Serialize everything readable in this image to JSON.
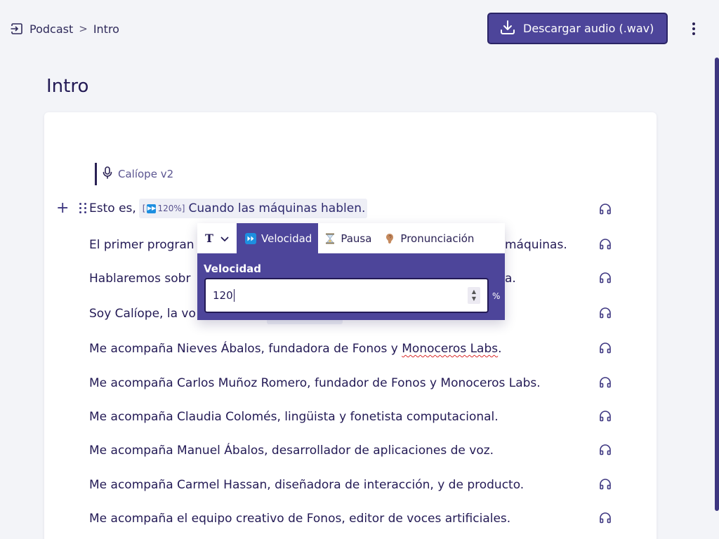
{
  "breadcrumb": {
    "root": "Podcast",
    "separator": ">",
    "current": "Intro"
  },
  "header": {
    "download_label": "Descargar audio (.wav)"
  },
  "page": {
    "title": "Intro"
  },
  "voice": {
    "name": "Calíope v2"
  },
  "first_line": {
    "prefix": "Esto es,",
    "tag": "120%]",
    "tag_open": "[",
    "highlighted": "Cuando las máquinas hablen."
  },
  "lines": [
    {
      "left": "El primer progran",
      "right": "máquinas."
    },
    {
      "left": "Hablaremos sobr",
      "right": "a."
    },
    {
      "left": "Soy Calíope, la vo",
      "right": ""
    },
    {
      "text_before": "Me acompaña Nieves Ábalos, fundadora de Fonos y ",
      "misspelled": "Monoceros Labs",
      "text_after": "."
    },
    {
      "text": "Me acompaña Carlos Muñoz Romero, fundador de Fonos y Monoceros Labs."
    },
    {
      "text": "Me acompaña Claudia Colomés, lingüista y fonetista computacional."
    },
    {
      "text": "Me acompaña Manuel Ábalos, desarrollador de aplicaciones de voz."
    },
    {
      "text": "Me acompaña Carmel Hassan, diseñadora de interacción, y de producto."
    },
    {
      "text": "Me acompaña el equipo creativo de Fonos, editor de voces artificiales."
    }
  ],
  "popover": {
    "text_style_glyph": "T",
    "tabs": [
      {
        "label": "Velocidad",
        "icon": "fast-forward-icon",
        "active": true
      },
      {
        "label": "Pausa",
        "icon": "hourglass-icon",
        "active": false
      },
      {
        "label": "Pronunciación",
        "icon": "ear-icon",
        "active": false
      }
    ],
    "field_label": "Velocidad",
    "value": "120",
    "unit": "%"
  },
  "colors": {
    "accent": "#4d459a",
    "text": "#231a55",
    "background": "#f3f4f8"
  }
}
